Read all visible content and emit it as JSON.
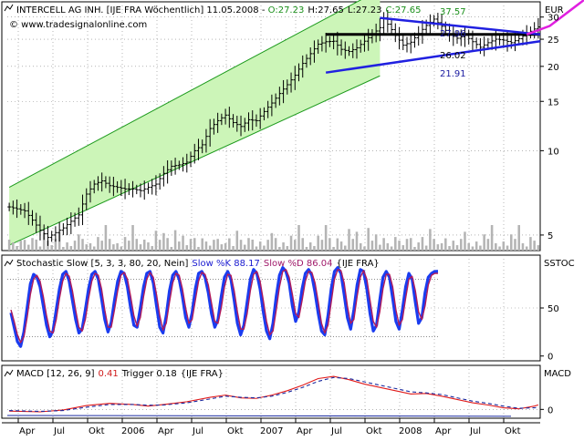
{
  "chart_data": [
    {
      "type": "candlestick",
      "title_parts": {
        "name": "INTERCELL AG INH. [IJE FRA  Wöchentlich] 11.05.2008",
        "open": "O:27.23",
        "high": "H:27.65",
        "low": "L:27.23",
        "close": "C:27.65"
      },
      "watermark": "© www.tradesignalonline.com",
      "yaxis_unit": "EUR",
      "yscale": "log",
      "ylim": [
        4.4,
        34
      ],
      "yticks": [
        5,
        10,
        15,
        20,
        25,
        30
      ],
      "x_axis_labels": [
        "Apr",
        "Jul",
        "Okt",
        "2006",
        "Apr",
        "Jul",
        "Okt",
        "2007",
        "Apr",
        "Jul",
        "Okt",
        "2008",
        "Apr",
        "Jul",
        "Okt"
      ],
      "annotations": [
        "37.57",
        "27.96",
        "26.02",
        "21.91"
      ],
      "price_path": [
        [
          0,
          6.3
        ],
        [
          4,
          6.1
        ],
        [
          8,
          5.2
        ],
        [
          10,
          4.9
        ],
        [
          12,
          5.1
        ],
        [
          14,
          5.3
        ],
        [
          16,
          5.6
        ],
        [
          18,
          5.9
        ],
        [
          20,
          7.0
        ],
        [
          22,
          7.6
        ],
        [
          24,
          7.8
        ],
        [
          26,
          7.5
        ],
        [
          28,
          7.4
        ],
        [
          30,
          7.3
        ],
        [
          32,
          7.3
        ],
        [
          34,
          7.2
        ],
        [
          36,
          7.4
        ],
        [
          38,
          7.6
        ],
        [
          40,
          8.3
        ],
        [
          42,
          8.8
        ],
        [
          44,
          8.9
        ],
        [
          46,
          9.1
        ],
        [
          48,
          10.0
        ],
        [
          50,
          10.5
        ],
        [
          52,
          12.0
        ],
        [
          54,
          12.8
        ],
        [
          56,
          13.4
        ],
        [
          58,
          12.6
        ],
        [
          60,
          12.2
        ],
        [
          62,
          12.9
        ],
        [
          64,
          12.8
        ],
        [
          66,
          13.8
        ],
        [
          68,
          14.8
        ],
        [
          70,
          16.0
        ],
        [
          72,
          17.2
        ],
        [
          74,
          18.6
        ],
        [
          76,
          20.5
        ],
        [
          78,
          22.2
        ],
        [
          80,
          24.0
        ],
        [
          82,
          24.5
        ],
        [
          84,
          24.6
        ],
        [
          86,
          23.0
        ],
        [
          88,
          22.6
        ],
        [
          90,
          23.3
        ],
        [
          92,
          24.6
        ],
        [
          94,
          26.0
        ],
        [
          96,
          27.5
        ],
        [
          97,
          29.8
        ],
        [
          98,
          28.3
        ],
        [
          100,
          25.8
        ],
        [
          102,
          23.8
        ],
        [
          104,
          24.4
        ],
        [
          106,
          26.2
        ],
        [
          108,
          28.0
        ],
        [
          110,
          29.5
        ],
        [
          112,
          27.8
        ],
        [
          114,
          26.0
        ],
        [
          116,
          25.2
        ],
        [
          118,
          25.8
        ],
        [
          120,
          24.5
        ],
        [
          122,
          23.4
        ],
        [
          124,
          24.3
        ],
        [
          126,
          25.0
        ],
        [
          128,
          24.8
        ],
        [
          130,
          24.3
        ],
        [
          132,
          25.1
        ],
        [
          134,
          26.2
        ],
        [
          136,
          27.2
        ],
        [
          137,
          27.65
        ]
      ],
      "volume_pattern": [
        3,
        2,
        1,
        2,
        2,
        1,
        2,
        3,
        1,
        4,
        2,
        1,
        2,
        3,
        1,
        2,
        1,
        2,
        3,
        2,
        1,
        2,
        1,
        3,
        2,
        5,
        2,
        1,
        2,
        1,
        3,
        2,
        6,
        2,
        1,
        3,
        2,
        1,
        4,
        2,
        3,
        2,
        1,
        5,
        2,
        3,
        1,
        2,
        2,
        1
      ],
      "channel": {
        "lower_start": 4.6,
        "lower_end": 18.5,
        "upper_start": 7.4,
        "upper_end": 37.57,
        "end_x": 96
      },
      "triangle": {
        "upper": [
          [
            96,
            29.8
          ],
          [
            155,
            26.0
          ]
        ],
        "lower": [
          [
            82,
            19.0
          ],
          [
            155,
            24.6
          ]
        ]
      },
      "support_line": {
        "value": 26.02,
        "x": [
          82,
          155
        ]
      },
      "projection": [
        [
          134,
          26.0
        ],
        [
          140,
          27.9
        ],
        [
          150,
          35.5
        ]
      ]
    },
    {
      "type": "line",
      "title_parts": {
        "name": "Stochastic Slow [5, 3, 3, 80, 20, Nein]",
        "k_label": "Slow %K 88.17",
        "d_label": "Slow %D 86.04",
        "suffix": "{IJE FRA}"
      },
      "yaxis_unit": "SSTOC",
      "ylim": [
        -5,
        105
      ],
      "yticks": [
        0,
        50
      ],
      "levels": [
        80,
        20
      ],
      "series": [
        {
          "name": "Slow %K",
          "values": [
            45,
            30,
            15,
            10,
            25,
            50,
            75,
            85,
            82,
            72,
            52,
            32,
            20,
            26,
            48,
            70,
            85,
            88,
            78,
            58,
            38,
            24,
            28,
            48,
            70,
            85,
            88,
            80,
            60,
            38,
            25,
            35,
            58,
            78,
            88,
            86,
            72,
            50,
            32,
            30,
            50,
            72,
            86,
            88,
            76,
            52,
            30,
            24,
            42,
            68,
            84,
            88,
            80,
            62,
            40,
            30,
            45,
            70,
            86,
            88,
            82,
            66,
            44,
            30,
            38,
            62,
            82,
            88,
            80,
            58,
            34,
            22,
            32,
            56,
            80,
            90,
            86,
            70,
            46,
            26,
            18,
            34,
            62,
            84,
            92,
            88,
            76,
            52,
            36,
            46,
            70,
            86,
            90,
            84,
            66,
            44,
            26,
            22,
            42,
            70,
            88,
            92,
            86,
            64,
            40,
            28,
            48,
            74,
            90,
            88,
            70,
            44,
            26,
            32,
            58,
            82,
            88,
            82,
            60,
            36,
            28,
            48,
            72,
            86,
            80,
            56,
            34,
            40,
            66,
            82,
            86,
            88,
            88.17
          ]
        },
        {
          "name": "Slow %D",
          "values": [
            48,
            36,
            22,
            14,
            20,
            40,
            64,
            80,
            84,
            78,
            62,
            42,
            26,
            24,
            38,
            60,
            78,
            86,
            83,
            68,
            48,
            30,
            26,
            38,
            60,
            78,
            86,
            84,
            70,
            48,
            30,
            30,
            48,
            68,
            84,
            87,
            80,
            62,
            42,
            31,
            40,
            62,
            80,
            87,
            82,
            64,
            42,
            27,
            34,
            56,
            76,
            86,
            84,
            70,
            50,
            34,
            38,
            58,
            78,
            87,
            85,
            74,
            55,
            36,
            34,
            50,
            72,
            85,
            84,
            68,
            46,
            28,
            28,
            44,
            68,
            85,
            88,
            78,
            58,
            36,
            22,
            26,
            48,
            72,
            88,
            90,
            82,
            64,
            44,
            40,
            58,
            78,
            88,
            87,
            76,
            56,
            34,
            24,
            32,
            56,
            80,
            90,
            89,
            76,
            52,
            34,
            38,
            62,
            82,
            89,
            80,
            58,
            36,
            30,
            46,
            70,
            85,
            85,
            72,
            48,
            32,
            38,
            60,
            80,
            83,
            68,
            46,
            38,
            52,
            74,
            84,
            86,
            86.04
          ]
        }
      ]
    },
    {
      "type": "line",
      "title_parts": {
        "name": "MACD [12, 26, 9]",
        "macd_label": "0.41",
        "trigger_label": "Trigger 0.18",
        "suffix": "{IJE FRA}"
      },
      "yaxis_unit": "MACD",
      "ylim": [
        -0.8,
        4.0
      ],
      "yticks": [
        0
      ],
      "series": [
        {
          "name": "MACD",
          "values": [
            [
              0,
              -0.15
            ],
            [
              8,
              -0.22
            ],
            [
              14,
              -0.05
            ],
            [
              20,
              0.35
            ],
            [
              26,
              0.55
            ],
            [
              32,
              0.45
            ],
            [
              36,
              0.3
            ],
            [
              40,
              0.45
            ],
            [
              46,
              0.7
            ],
            [
              52,
              1.1
            ],
            [
              56,
              1.3
            ],
            [
              60,
              1.05
            ],
            [
              64,
              1.0
            ],
            [
              68,
              1.3
            ],
            [
              72,
              1.7
            ],
            [
              76,
              2.2
            ],
            [
              80,
              2.8
            ],
            [
              84,
              3.0
            ],
            [
              88,
              2.7
            ],
            [
              92,
              2.3
            ],
            [
              96,
              2.0
            ],
            [
              100,
              1.7
            ],
            [
              104,
              1.4
            ],
            [
              108,
              1.45
            ],
            [
              112,
              1.2
            ],
            [
              116,
              0.9
            ],
            [
              120,
              0.6
            ],
            [
              124,
              0.4
            ],
            [
              128,
              0.15
            ],
            [
              132,
              0.05
            ],
            [
              136,
              0.3
            ],
            [
              137,
              0.41
            ]
          ]
        },
        {
          "name": "Trigger",
          "values": [
            [
              0,
              -0.1
            ],
            [
              8,
              -0.18
            ],
            [
              14,
              -0.1
            ],
            [
              20,
              0.2
            ],
            [
              26,
              0.45
            ],
            [
              32,
              0.45
            ],
            [
              36,
              0.38
            ],
            [
              40,
              0.4
            ],
            [
              46,
              0.6
            ],
            [
              52,
              0.95
            ],
            [
              56,
              1.2
            ],
            [
              60,
              1.1
            ],
            [
              64,
              1.05
            ],
            [
              68,
              1.2
            ],
            [
              72,
              1.55
            ],
            [
              76,
              2.0
            ],
            [
              80,
              2.55
            ],
            [
              84,
              2.9
            ],
            [
              88,
              2.8
            ],
            [
              92,
              2.5
            ],
            [
              96,
              2.2
            ],
            [
              100,
              1.9
            ],
            [
              104,
              1.6
            ],
            [
              108,
              1.5
            ],
            [
              112,
              1.35
            ],
            [
              116,
              1.05
            ],
            [
              120,
              0.75
            ],
            [
              124,
              0.55
            ],
            [
              128,
              0.3
            ],
            [
              132,
              0.1
            ],
            [
              136,
              0.15
            ],
            [
              137,
              0.18
            ]
          ]
        }
      ]
    }
  ]
}
